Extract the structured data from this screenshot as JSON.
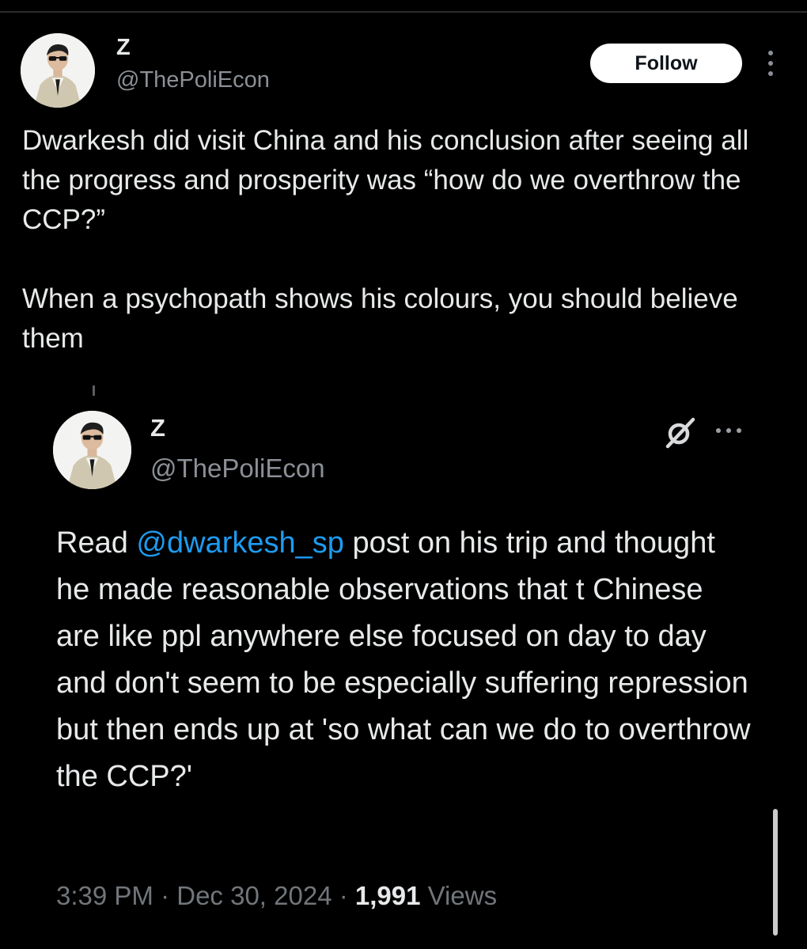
{
  "tweet": {
    "author_name": "Z",
    "author_handle": "@ThePoliEcon",
    "follow_label": "Follow",
    "paragraphs": [
      "Dwarkesh did visit China and his conclusion after seeing all the progress and prosperity was “how do we overthrow the CCP?”",
      "When a psychopath shows his colours, you should believe them"
    ]
  },
  "quoted": {
    "author_name": "Z",
    "author_handle": "@ThePoliEcon",
    "text_prefix": "Read ",
    "mention": "@dwarkesh_sp",
    "text_suffix": " post on his trip and thought he made reasonable observations that t Chinese are like ppl anywhere else focused on day to day and don't seem to be especially suffering repression but then ends up at 'so what can we do to overthrow the CCP?'",
    "time": "3:39 PM",
    "date": "Dec 30, 2024",
    "separator": " · ",
    "views_count": "1,991",
    "views_label": " Views"
  },
  "icons": {
    "avatar": "profile-photo-man-with-sunglasses",
    "more_vertical": "more-vertical-icon",
    "more_horizontal": "more-horizontal-icon",
    "grok": "grok-icon"
  },
  "colors": {
    "background": "#000000",
    "text": "#e7e9ea",
    "secondary": "#71767b",
    "link": "#1d9bf0",
    "follow_bg": "#ffffff"
  }
}
